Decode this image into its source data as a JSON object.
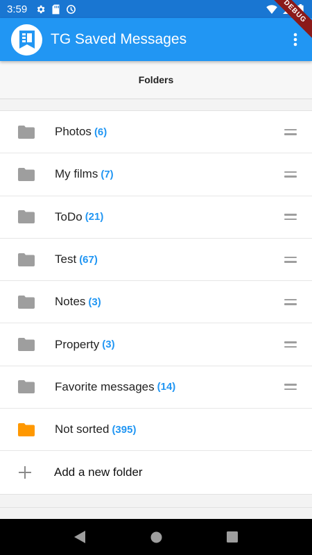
{
  "status_bar": {
    "time": "3:59",
    "icons_left": [
      "gear-icon",
      "sd-card-icon",
      "vpn-icon"
    ],
    "icons_right": [
      "wifi-icon",
      "signal-icon",
      "battery-icon"
    ],
    "color": "#1976D2"
  },
  "debug_banner": "DEBUG",
  "app_bar": {
    "title": "TG Saved Messages",
    "logo_icon": "bookmark-logo-icon",
    "menu_icon": "more-vert-icon",
    "color": "#2196F3"
  },
  "header": {
    "title": "Folders"
  },
  "folders": [
    {
      "name": "Photos",
      "count": "(6)",
      "icon": "folder-icon",
      "color": "#9E9E9E",
      "reorderable": true
    },
    {
      "name": "My films",
      "count": "(7)",
      "icon": "folder-icon",
      "color": "#9E9E9E",
      "reorderable": true
    },
    {
      "name": "ToDo",
      "count": "(21)",
      "icon": "folder-icon",
      "color": "#9E9E9E",
      "reorderable": true
    },
    {
      "name": "Test",
      "count": "(67)",
      "icon": "folder-icon",
      "color": "#9E9E9E",
      "reorderable": true
    },
    {
      "name": "Notes",
      "count": "(3)",
      "icon": "folder-icon",
      "color": "#9E9E9E",
      "reorderable": true
    },
    {
      "name": "Property",
      "count": "(3)",
      "icon": "folder-icon",
      "color": "#9E9E9E",
      "reorderable": true
    },
    {
      "name": "Favorite messages",
      "count": "(14)",
      "icon": "folder-icon",
      "color": "#9E9E9E",
      "reorderable": true
    },
    {
      "name": "Not sorted",
      "count": "(395)",
      "icon": "folder-icon",
      "color": "#FF9800",
      "reorderable": false
    }
  ],
  "add_folder": {
    "label": "Add a new folder",
    "icon": "plus-icon"
  },
  "count_color": "#2196F3",
  "nav_bar": {
    "buttons": [
      "back-icon",
      "home-icon",
      "recents-icon"
    ]
  }
}
